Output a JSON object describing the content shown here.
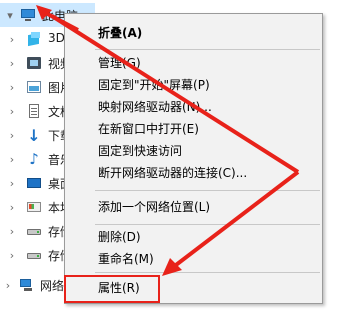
{
  "tree": {
    "items": [
      {
        "label": "此电脑",
        "icon": "computer-icon"
      },
      {
        "label": "3D",
        "icon": "3d-objects-icon"
      },
      {
        "label": "视频",
        "icon": "video-icon"
      },
      {
        "label": "图片",
        "icon": "pictures-icon"
      },
      {
        "label": "文档",
        "icon": "documents-icon"
      },
      {
        "label": "下载",
        "icon": "download-icon"
      },
      {
        "label": "音乐",
        "icon": "music-icon"
      },
      {
        "label": "桌面",
        "icon": "desktop-icon"
      },
      {
        "label": "本地",
        "icon": "local-disk-icon"
      },
      {
        "label": "存储",
        "icon": "drive-icon"
      },
      {
        "label": "存储",
        "icon": "drive-icon"
      },
      {
        "label": "网络",
        "icon": "network-icon"
      }
    ]
  },
  "menu": {
    "items": [
      {
        "label": "折叠(A)",
        "bold": true
      },
      {
        "label": "管理(G)"
      },
      {
        "label": "固定到\"开始\"屏幕(P)"
      },
      {
        "label": "映射网络驱动器(N)..."
      },
      {
        "label": "在新窗口中打开(E)"
      },
      {
        "label": "固定到快速访问"
      },
      {
        "label": "断开网络驱动器的连接(C)..."
      },
      {
        "label": "添加一个网络位置(L)"
      },
      {
        "label": "删除(D)"
      },
      {
        "label": "重命名(M)"
      },
      {
        "label": "属性(R)"
      }
    ]
  },
  "colors": {
    "annotation": "#e8221a",
    "selection": "#cce8ff",
    "menu_bg": "#f2f2f2"
  }
}
